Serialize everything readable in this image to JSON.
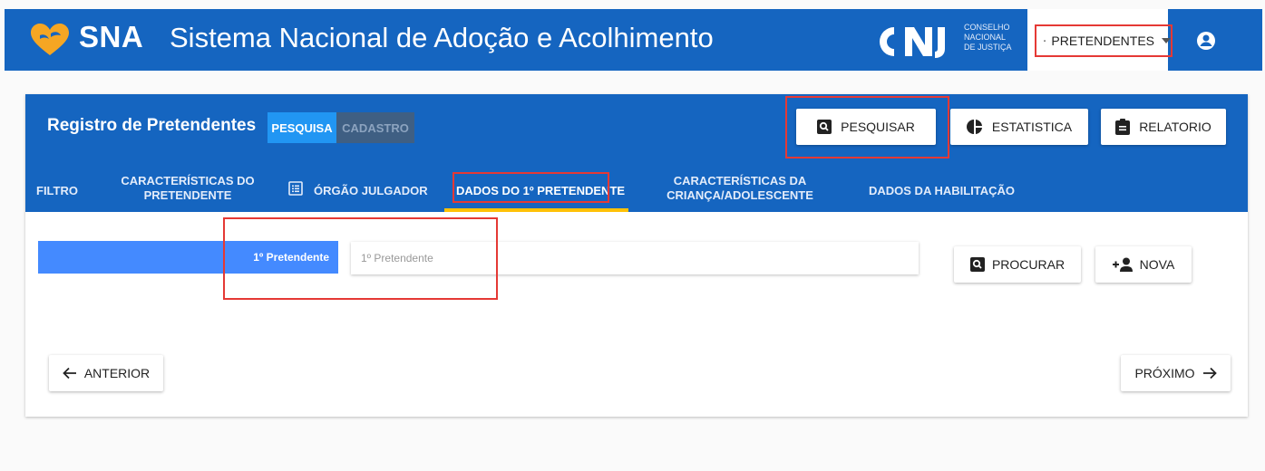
{
  "header": {
    "brand": "SNA",
    "title": "Sistema Nacional de Adoção e Acolhimento",
    "cnj_lines": [
      "CONSELHO",
      "NACIONAL",
      "DE JUSTIÇA"
    ],
    "role_label": "PRETENDENTES"
  },
  "card": {
    "title": "Registro de Pretendentes",
    "mode_tabs": {
      "search": "PESQUISA",
      "register": "CADASTRO"
    },
    "actions": {
      "search": "PESQUISAR",
      "stats": "ESTATISTICA",
      "report": "RELATORIO"
    },
    "tabs": {
      "filter": "FILTRO",
      "applicant_char_1": "CARACTERÍSTICAS DO",
      "applicant_char_2": "PRETENDENTE",
      "court": "ÓRGÃO JULGADOR",
      "first_applicant": "DADOS DO 1º PRETENDENTE",
      "child_char_1": "CARACTERÍSTICAS DA",
      "child_char_2": "CRIANÇA/ADOLESCENTE",
      "qualification": "DADOS DA HABILITAÇÃO"
    },
    "form": {
      "label": "1º Pretendente",
      "placeholder": "1º Pretendente",
      "value": ""
    },
    "buttons": {
      "find": "PROCURAR",
      "new": "NOVA",
      "prev": "ANTERIOR",
      "next": "PRÓXIMO"
    }
  },
  "colors": {
    "primary": "#1565c0",
    "accent": "#2196f3",
    "highlight": "#e53935",
    "tab_indicator": "#ffc107"
  }
}
